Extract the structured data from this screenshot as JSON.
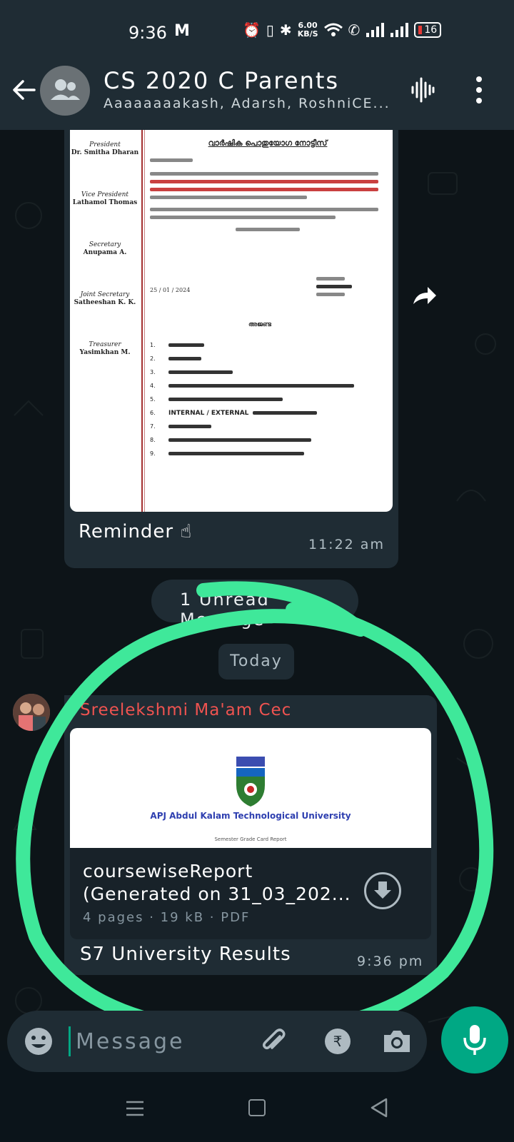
{
  "status_bar": {
    "time": "9:36",
    "mail_icon": "M",
    "net_speed_value": "6.00",
    "net_speed_unit": "KB/S",
    "battery": "16"
  },
  "header": {
    "title": "CS 2020 C Parents",
    "participants": "Aaaaaaaakash, Adarsh, RoshniCE..."
  },
  "messages": [
    {
      "type": "image",
      "document": {
        "officers": [
          {
            "role": "President",
            "name": "Dr. Smitha Dharan"
          },
          {
            "role": "Vice President",
            "name": "Lathamol Thomas"
          },
          {
            "role": "Secretary",
            "name": "Anupama A."
          },
          {
            "role": "Joint Secretary",
            "name": "Satheeshan K. K."
          },
          {
            "role": "Treasurer",
            "name": "Yasimkhan M."
          }
        ],
        "heading": "വാർഷിക പൊതുയോഗ നോട്ടീസ്",
        "date": "25 / 01 / 2024",
        "agenda_title": "അജണ്ട",
        "agenda_internal": "INTERNAL / EXTERNAL"
      },
      "caption": "Reminder ☝",
      "time": "11:22 am"
    },
    {
      "type": "pdf",
      "sender": "Sreelekshmi Ma'am Cec",
      "thumb_title": "APJ Abdul Kalam Technological University",
      "thumb_subtitle": "Semester Grade Card Report",
      "file_name_line1": "coursewiseReport",
      "file_name_line2": "(Generated on 31_03_202...",
      "file_meta": "4 pages · 19 kB · PDF",
      "caption": "S7 University Results",
      "time": "9:36 pm"
    }
  ],
  "unread_banner": "1 Unread Message",
  "date_divider": "Today",
  "input": {
    "placeholder": "Message"
  },
  "icons": {
    "back": "arrow-left-icon",
    "group_avatar": "group-icon",
    "voice_chat": "waveform-icon",
    "more": "more-vert-icon",
    "forward": "forward-icon",
    "download": "download-icon",
    "emoji": "emoji-icon",
    "attach": "paperclip-icon",
    "payment": "rupee-icon",
    "camera": "camera-icon",
    "mic": "mic-icon"
  },
  "colors": {
    "accent": "#00a884",
    "sender_name": "#ef5350",
    "highlight_circle": "#3fe89a"
  }
}
